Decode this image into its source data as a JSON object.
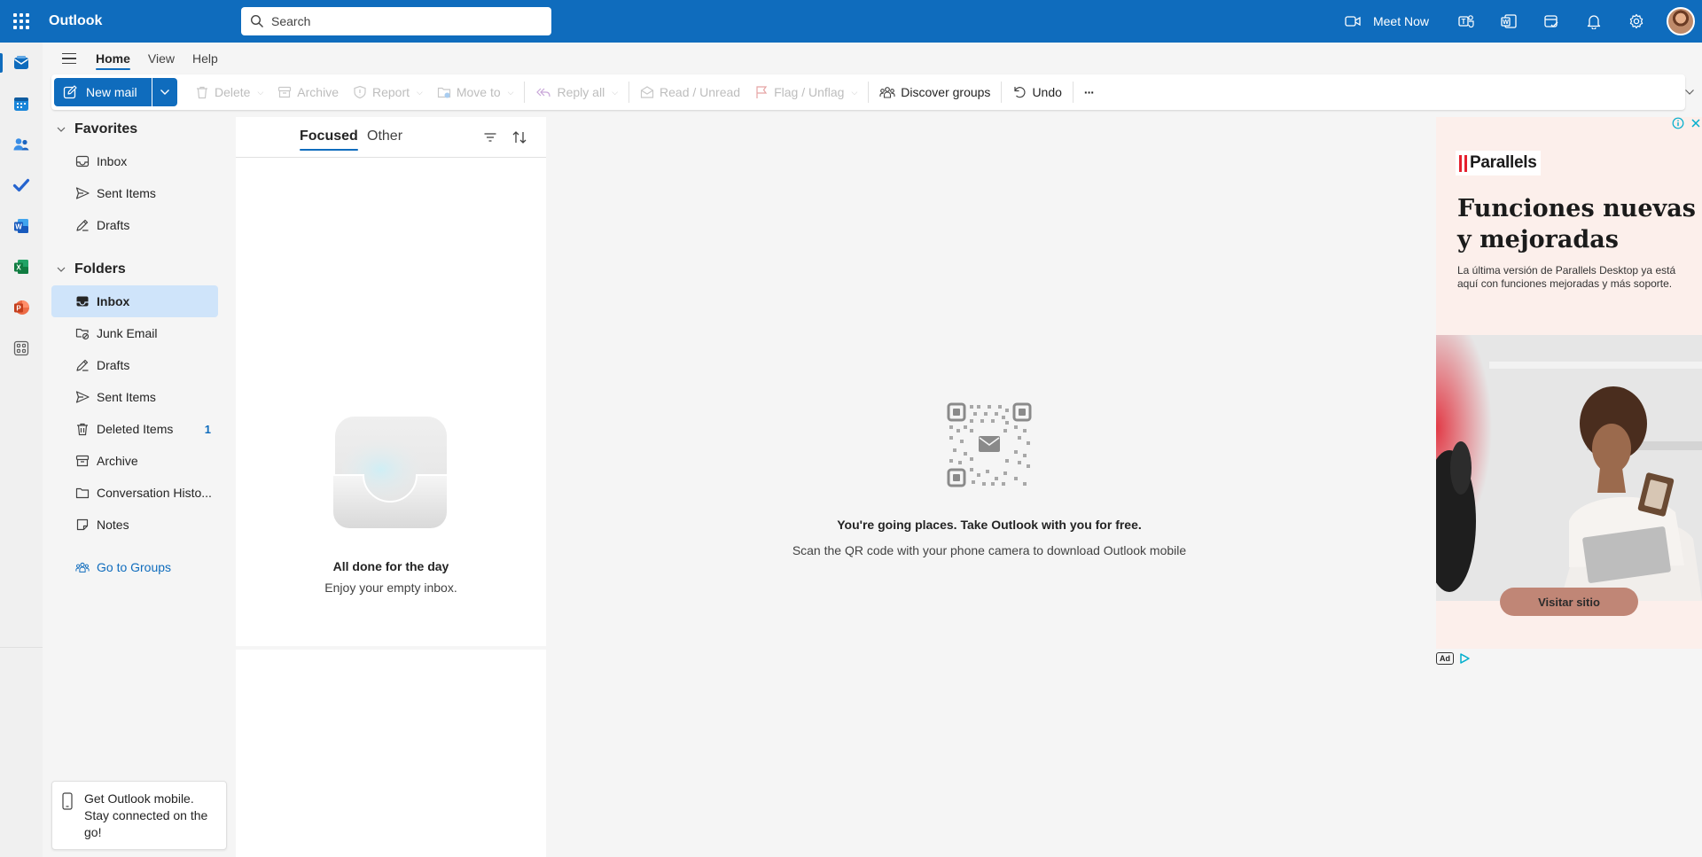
{
  "app": {
    "title": "Outlook"
  },
  "search": {
    "placeholder": "Search"
  },
  "header": {
    "meet_now": "Meet Now"
  },
  "menu": {
    "tabs": [
      {
        "label": "Home"
      },
      {
        "label": "View"
      },
      {
        "label": "Help"
      }
    ]
  },
  "ribbon": {
    "new_mail": "New mail",
    "delete": "Delete",
    "archive": "Archive",
    "report": "Report",
    "move_to": "Move to",
    "reply_all": "Reply all",
    "read_unread": "Read / Unread",
    "flag_unflag": "Flag / Unflag",
    "discover_groups": "Discover groups",
    "undo": "Undo",
    "more": "···"
  },
  "folders": {
    "favorites_label": "Favorites",
    "favorites": [
      {
        "label": "Inbox"
      },
      {
        "label": "Sent Items"
      },
      {
        "label": "Drafts"
      }
    ],
    "folders_label": "Folders",
    "items": [
      {
        "label": "Inbox"
      },
      {
        "label": "Junk Email"
      },
      {
        "label": "Drafts"
      },
      {
        "label": "Sent Items"
      },
      {
        "label": "Deleted Items",
        "count": "1"
      },
      {
        "label": "Archive"
      },
      {
        "label": "Conversation Histo..."
      },
      {
        "label": "Notes"
      }
    ],
    "go_to_groups": "Go to Groups"
  },
  "mobile_card": {
    "text": "Get Outlook mobile. Stay connected on the go!"
  },
  "message_list": {
    "focused": "Focused",
    "other": "Other",
    "empty_title": "All done for the day",
    "empty_subtitle": "Enjoy your empty inbox."
  },
  "reading_pane": {
    "title": "You're going places. Take Outlook with you for free.",
    "subtitle": "Scan the QR code with your phone camera to download Outlook mobile"
  },
  "ad": {
    "brand": "Parallels",
    "headline": "Funciones nuevas y mejoradas",
    "body": "La última versión de Parallels Desktop ya está aquí con funciones mejoradas y más soporte.",
    "cta": "Visitar sitio",
    "ad_label": "Ad"
  },
  "colors": {
    "accent": "#0f6cbd",
    "selected": "#cfe4fa",
    "ad_background": "#fcefeb",
    "ad_cta": "#c08676"
  }
}
